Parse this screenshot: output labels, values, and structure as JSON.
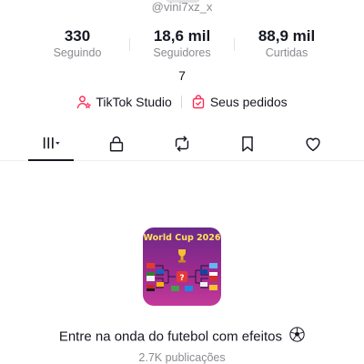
{
  "profile": {
    "username": "@vini7xz_x",
    "bio": "7"
  },
  "stats": [
    {
      "value": "330",
      "label": "Seguindo"
    },
    {
      "value": "18,6 mil",
      "label": "Seguidores"
    },
    {
      "value": "88,9 mil",
      "label": "Curtidas"
    }
  ],
  "links": {
    "studio": "TikTok Studio",
    "orders": "Seus pedidos"
  },
  "tabs": [
    {
      "name": "videos",
      "icon": "grid-icon",
      "active": true
    },
    {
      "name": "private",
      "icon": "lock-icon"
    },
    {
      "name": "reposts",
      "icon": "repost-icon"
    },
    {
      "name": "favorites",
      "icon": "bookmark-icon"
    },
    {
      "name": "liked",
      "icon": "heart-icon"
    }
  ],
  "promo": {
    "image_title": "World Cup 2026",
    "caption": "Entre na onda do futebol com efeitos",
    "caption_emoji": "⚽",
    "count": "2.7K publicações"
  },
  "colors": {
    "accent": "#fe2c55",
    "text": "#161823",
    "muted": "#8a8b91",
    "icon_bg": "#9d2a8f"
  }
}
